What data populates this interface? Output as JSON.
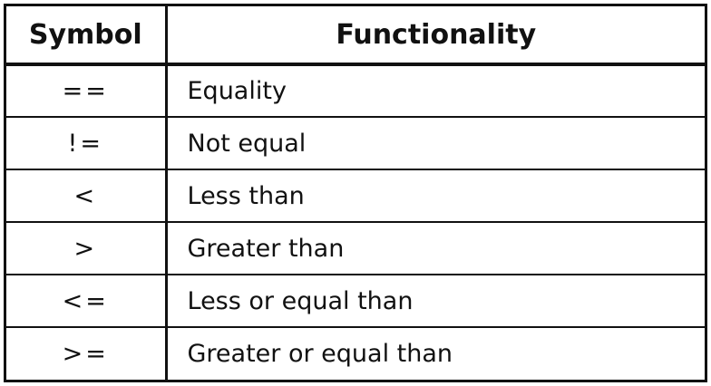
{
  "table": {
    "headers": {
      "symbol": "Symbol",
      "functionality": "Functionality"
    },
    "rows": [
      {
        "symbol": "==",
        "functionality": "Equality"
      },
      {
        "symbol": "!=",
        "functionality": "Not equal"
      },
      {
        "symbol": "<",
        "functionality": "Less than"
      },
      {
        "symbol": ">",
        "functionality": "Greater than"
      },
      {
        "symbol": "<=",
        "functionality": "Less or equal than"
      },
      {
        "symbol": ">=",
        "functionality": "Greater or equal than"
      }
    ]
  }
}
